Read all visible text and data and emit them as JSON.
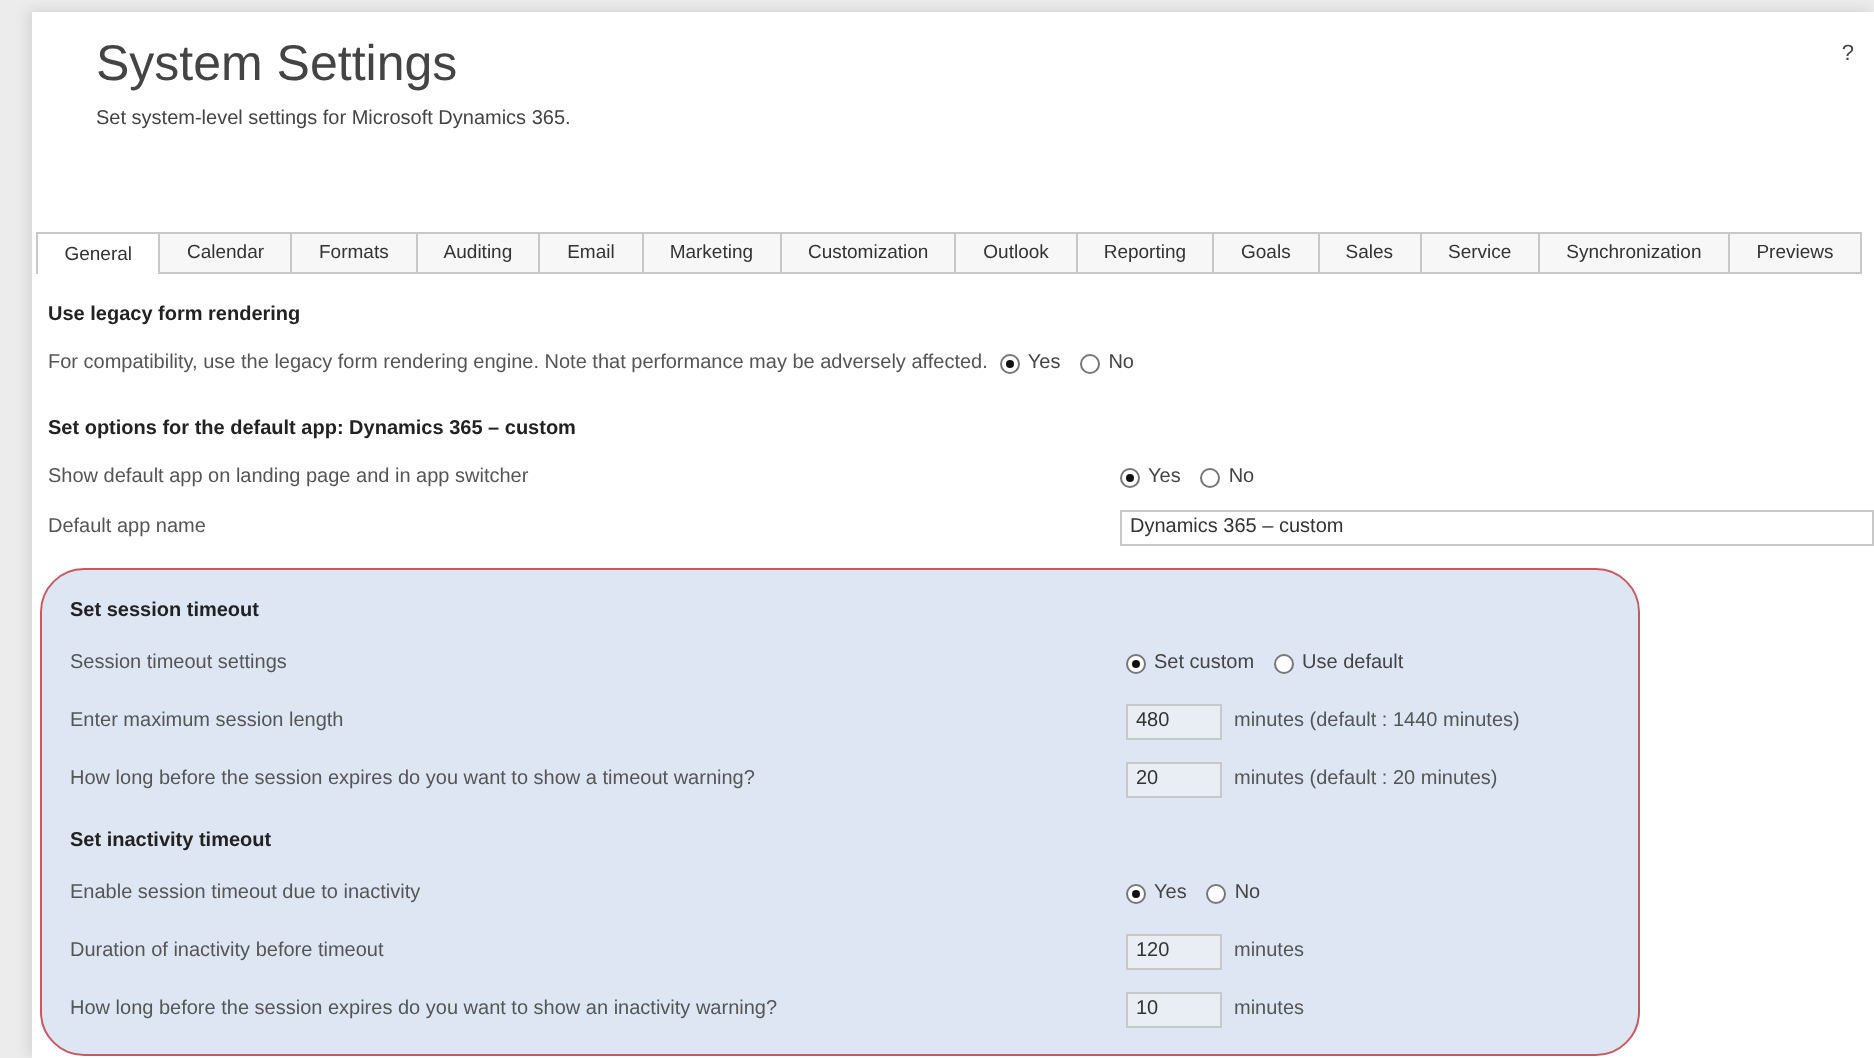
{
  "header": {
    "title": "System Settings",
    "subtitle": "Set system-level settings for Microsoft Dynamics 365.",
    "help": "?"
  },
  "tabs": [
    {
      "label": "General",
      "selected": true
    },
    {
      "label": "Calendar",
      "selected": false
    },
    {
      "label": "Formats",
      "selected": false
    },
    {
      "label": "Auditing",
      "selected": false
    },
    {
      "label": "Email",
      "selected": false
    },
    {
      "label": "Marketing",
      "selected": false
    },
    {
      "label": "Customization",
      "selected": false
    },
    {
      "label": "Outlook",
      "selected": false
    },
    {
      "label": "Reporting",
      "selected": false
    },
    {
      "label": "Goals",
      "selected": false
    },
    {
      "label": "Sales",
      "selected": false
    },
    {
      "label": "Service",
      "selected": false
    },
    {
      "label": "Synchronization",
      "selected": false
    },
    {
      "label": "Previews",
      "selected": false
    }
  ],
  "groups": [
    {
      "highlighted": false,
      "sections": [
        {
          "title": "Use legacy form rendering",
          "rows": [
            {
              "kind": "inline-radio",
              "label": "For compatibility, use the legacy form rendering engine. Note that performance may be adversely affected.",
              "options": [
                {
                  "label": "Yes",
                  "selected": true
                },
                {
                  "label": "No",
                  "selected": false
                }
              ]
            }
          ]
        },
        {
          "title": "Set options for the default app: Dynamics 365 – custom",
          "rows": [
            {
              "kind": "radio",
              "label": "Show default app on landing page and in app switcher",
              "options": [
                {
                  "label": "Yes",
                  "selected": true
                },
                {
                  "label": "No",
                  "selected": false
                }
              ]
            },
            {
              "kind": "text",
              "label": "Default app name",
              "value": "Dynamics 365 – custom"
            }
          ]
        }
      ]
    },
    {
      "highlighted": true,
      "sections": [
        {
          "title": "Set session timeout",
          "rows": [
            {
              "kind": "radio",
              "label": "Session timeout settings",
              "options": [
                {
                  "label": "Set custom",
                  "selected": true
                },
                {
                  "label": "Use default",
                  "selected": false
                }
              ]
            },
            {
              "kind": "number",
              "label": "Enter maximum session length",
              "value": "480",
              "unit": "minutes (default : 1440 minutes)"
            },
            {
              "kind": "number",
              "label": "How long before the session expires do you want to show a timeout warning?",
              "value": "20",
              "unit": "minutes (default : 20 minutes)"
            }
          ]
        },
        {
          "title": "Set inactivity timeout",
          "rows": [
            {
              "kind": "radio",
              "label": "Enable session timeout due to inactivity",
              "options": [
                {
                  "label": "Yes",
                  "selected": true
                },
                {
                  "label": "No",
                  "selected": false
                }
              ]
            },
            {
              "kind": "number",
              "label": "Duration of inactivity before timeout",
              "value": "120",
              "unit": "minutes"
            },
            {
              "kind": "number",
              "label": "How long before the session expires do you want to show an inactivity warning?",
              "value": "10",
              "unit": "minutes"
            }
          ]
        }
      ]
    }
  ]
}
